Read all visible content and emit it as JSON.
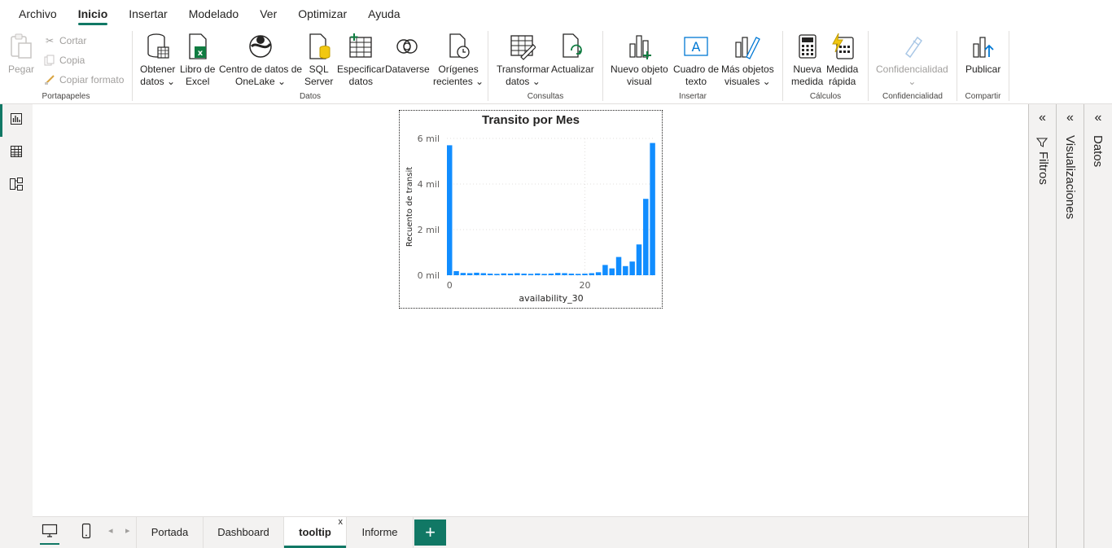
{
  "menu": {
    "items": [
      "Archivo",
      "Inicio",
      "Insertar",
      "Modelado",
      "Ver",
      "Optimizar",
      "Ayuda"
    ],
    "active": "Inicio"
  },
  "ribbon": {
    "portapapeles": {
      "label": "Portapapeles",
      "pegar": "Pegar",
      "cortar": "Cortar",
      "copia": "Copia",
      "copiar_formato": "Copiar formato"
    },
    "datos": {
      "label": "Datos",
      "obtener_datos": [
        "Obtener",
        "datos"
      ],
      "libro_excel": [
        "Libro de",
        "Excel"
      ],
      "onelake": [
        "Centro de datos de",
        "OneLake"
      ],
      "sql_server": [
        "SQL",
        "Server"
      ],
      "especificar": [
        "Especificar",
        "datos"
      ],
      "dataverse": "Dataverse",
      "origenes": [
        "Orígenes",
        "recientes"
      ]
    },
    "consultas": {
      "label": "Consultas",
      "transformar": [
        "Transformar",
        "datos"
      ],
      "actualizar": "Actualizar"
    },
    "insertar": {
      "label": "Insertar",
      "nuevo_objeto": [
        "Nuevo objeto",
        "visual"
      ],
      "cuadro_texto": [
        "Cuadro de",
        "texto"
      ],
      "mas_objetos": [
        "Más objetos",
        "visuales"
      ]
    },
    "calculos": {
      "label": "Cálculos",
      "nueva_medida": [
        "Nueva",
        "medida"
      ],
      "medida_rapida": [
        "Medida",
        "rápida"
      ]
    },
    "confidencialidad": {
      "label": "Confidencialidad",
      "button": "Confidencialidad"
    },
    "compartir": {
      "label": "Compartir",
      "publicar": "Publicar"
    }
  },
  "panes": {
    "filtros": "Filtros",
    "visualizaciones": "Visualizaciones",
    "datos": "Datos"
  },
  "tabs": {
    "pages": [
      "Portada",
      "Dashboard",
      "tooltip",
      "Informe"
    ],
    "active": "tooltip",
    "close": "x",
    "add": "+"
  },
  "colors": {
    "accent": "#117865",
    "bar": "#118dff"
  },
  "chart_data": {
    "type": "bar",
    "title": "Transito por Mes",
    "xlabel": "availability_30",
    "ylabel": "Recuento de transit",
    "x": [
      0,
      1,
      2,
      3,
      4,
      5,
      6,
      7,
      8,
      9,
      10,
      11,
      12,
      13,
      14,
      15,
      16,
      17,
      18,
      19,
      20,
      21,
      22,
      23,
      24,
      25,
      26,
      27,
      28,
      29,
      30
    ],
    "values": [
      5700,
      180,
      100,
      90,
      110,
      90,
      70,
      60,
      80,
      70,
      90,
      70,
      60,
      80,
      60,
      70,
      100,
      90,
      70,
      60,
      70,
      90,
      130,
      450,
      300,
      800,
      400,
      600,
      1350,
      3350,
      5800
    ],
    "ylim": [
      0,
      6000
    ],
    "yticks": [
      0,
      2000,
      4000,
      6000
    ],
    "ytick_labels": [
      "0 mil",
      "2 mil",
      "4 mil",
      "6 mil"
    ],
    "xticks": [
      0,
      20
    ],
    "xtick_labels": [
      "0",
      "20"
    ],
    "grid": true
  }
}
